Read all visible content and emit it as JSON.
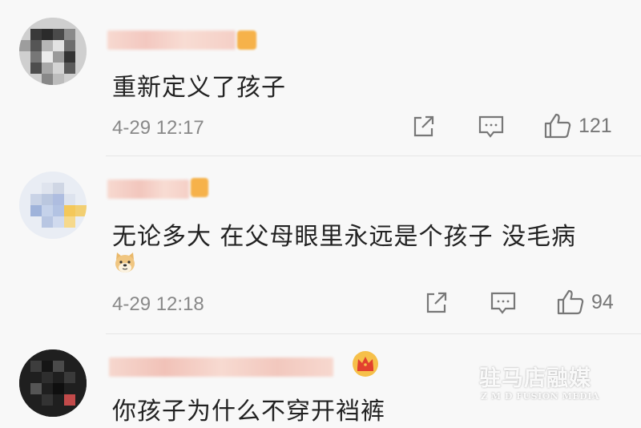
{
  "comments": [
    {
      "username": "",
      "text": "重新定义了孩子",
      "timestamp": "4-29 12:17",
      "likes": "121",
      "has_emoji": false
    },
    {
      "username": "",
      "text": "无论多大 在父母眼里永远是个孩子 没毛病",
      "timestamp": "4-29 12:18",
      "likes": "94",
      "has_emoji": true,
      "emoji": "doge-emoji"
    },
    {
      "username": "",
      "text": "你孩子为什么不穿开裆裤",
      "has_crown_badge": true
    }
  ],
  "icons": {
    "share": "share-icon",
    "reply": "comment-icon",
    "like": "thumbs-up-icon"
  },
  "watermark": {
    "line1": "驻马店融媒",
    "line2": "Z M D FUSION MEDIA"
  },
  "colors": {
    "background": "#f8f8f8",
    "text": "#222222",
    "meta": "#888888",
    "icon": "#777777",
    "badge_orange": "#f6b24a"
  }
}
